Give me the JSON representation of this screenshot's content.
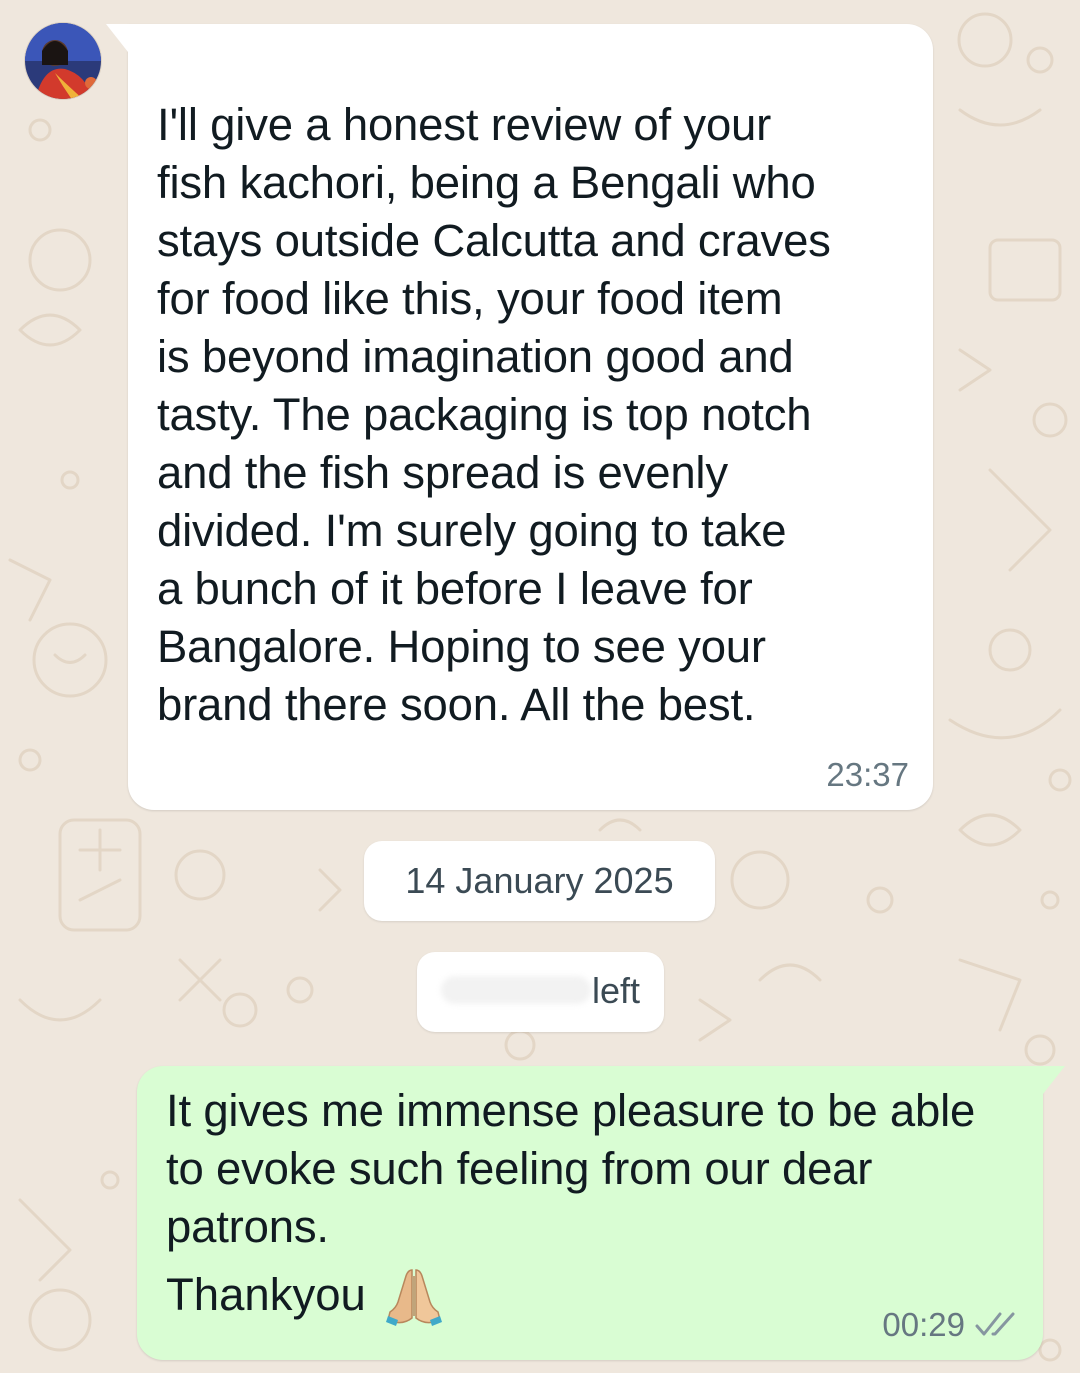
{
  "chat": {
    "incoming": {
      "text": "I'll give a honest review of your\nfish kachori, being a Bengali who\nstays outside Calcutta and craves\nfor food like this, your food item\nis beyond imagination good and\ntasty. The packaging is top notch\nand the fish spread is evenly\ndivided. I'm surely going to take\na bunch of it before I leave for\nBangalore. Hoping to see your\nbrand there soon. All the best.",
      "time": "23:37"
    },
    "date_separator": "14 January 2025",
    "system_notice": {
      "suffix": "left"
    },
    "outgoing": {
      "text": "It gives me immense pleasure to be able to evoke such feeling from our dear patrons.",
      "signoff": "Thankyou",
      "emoji_icon": "folded-hands-emoji",
      "time": "00:29",
      "status_icon": "double-check-icon"
    }
  },
  "colors": {
    "wallpaper": "#efe7dd",
    "incoming_bubble": "#ffffff",
    "outgoing_bubble": "#d9fdd3",
    "timestamp": "#667781"
  }
}
